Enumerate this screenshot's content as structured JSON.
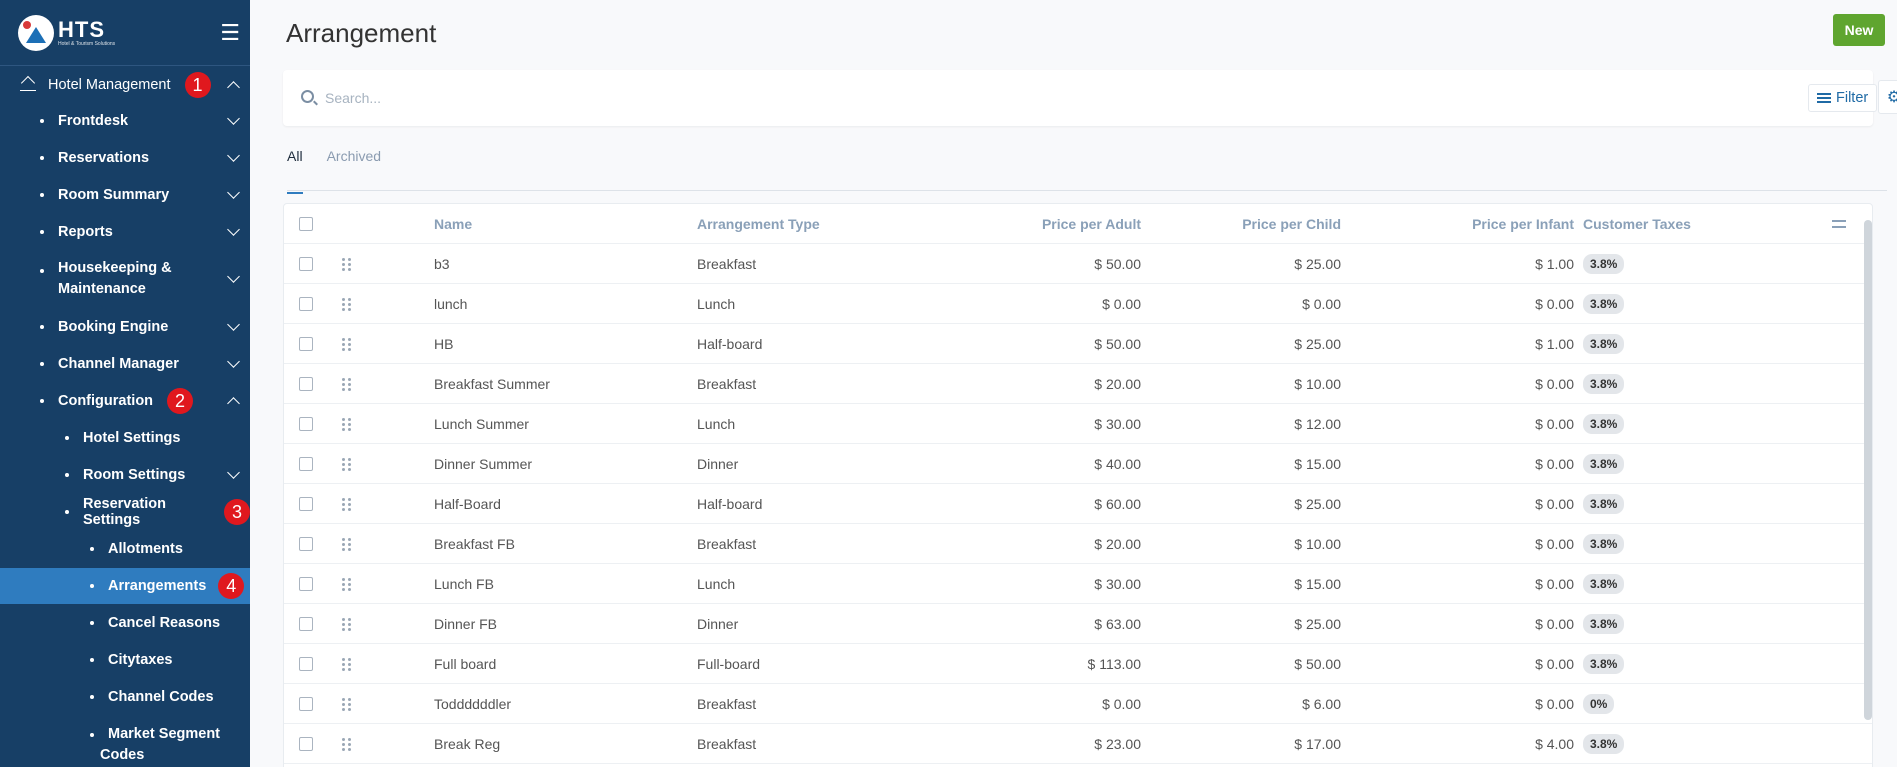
{
  "sidebar": {
    "logo": {
      "main": "HTS",
      "sub": "Hotel & Tourism Solutions"
    },
    "items": [
      {
        "label": "Hotel Management",
        "badge": "1"
      },
      {
        "label": "Frontdesk"
      },
      {
        "label": "Reservations"
      },
      {
        "label": "Room Summary"
      },
      {
        "label": "Reports"
      },
      {
        "label": "Housekeeping &",
        "label2": "Maintenance"
      },
      {
        "label": "Booking Engine"
      },
      {
        "label": "Channel Manager"
      },
      {
        "label": "Configuration",
        "badge": "2"
      },
      {
        "label": "Hotel Settings"
      },
      {
        "label": "Room Settings"
      },
      {
        "label": "Reservation Settings",
        "badge": "3"
      },
      {
        "label": "Allotments"
      },
      {
        "label": "Arrangements",
        "badge": "4"
      },
      {
        "label": "Cancel Reasons"
      },
      {
        "label": "Citytaxes"
      },
      {
        "label": "Channel Codes"
      },
      {
        "label": "Market Segment",
        "label2": "Codes"
      }
    ]
  },
  "header": {
    "title": "Arrangement",
    "new_label": "New"
  },
  "search": {
    "placeholder": "Search...",
    "filter_label": "Filter"
  },
  "tabs": [
    {
      "label": "All"
    },
    {
      "label": "Archived"
    }
  ],
  "table": {
    "columns": [
      "Name",
      "Arrangement Type",
      "Price per Adult",
      "Price per Child",
      "Price per Infant",
      "Customer Taxes"
    ],
    "rows": [
      {
        "name": "b3",
        "type": "Breakfast",
        "adult": "$ 50.00",
        "child": "$ 25.00",
        "infant": "$ 1.00",
        "tax": "3.8%"
      },
      {
        "name": "lunch",
        "type": "Lunch",
        "adult": "$ 0.00",
        "child": "$ 0.00",
        "infant": "$ 0.00",
        "tax": "3.8%"
      },
      {
        "name": "HB",
        "type": "Half-board",
        "adult": "$ 50.00",
        "child": "$ 25.00",
        "infant": "$ 1.00",
        "tax": "3.8%"
      },
      {
        "name": "Breakfast Summer",
        "type": "Breakfast",
        "adult": "$ 20.00",
        "child": "$ 10.00",
        "infant": "$ 0.00",
        "tax": "3.8%"
      },
      {
        "name": "Lunch Summer",
        "type": "Lunch",
        "adult": "$ 30.00",
        "child": "$ 12.00",
        "infant": "$ 0.00",
        "tax": "3.8%"
      },
      {
        "name": "Dinner Summer",
        "type": "Dinner",
        "adult": "$ 40.00",
        "child": "$ 15.00",
        "infant": "$ 0.00",
        "tax": "3.8%"
      },
      {
        "name": "Half-Board",
        "type": "Half-board",
        "adult": "$ 60.00",
        "child": "$ 25.00",
        "infant": "$ 0.00",
        "tax": "3.8%"
      },
      {
        "name": "Breakfast FB",
        "type": "Breakfast",
        "adult": "$ 20.00",
        "child": "$ 10.00",
        "infant": "$ 0.00",
        "tax": "3.8%"
      },
      {
        "name": "Lunch FB",
        "type": "Lunch",
        "adult": "$ 30.00",
        "child": "$ 15.00",
        "infant": "$ 0.00",
        "tax": "3.8%"
      },
      {
        "name": "Dinner FB",
        "type": "Dinner",
        "adult": "$ 63.00",
        "child": "$ 25.00",
        "infant": "$ 0.00",
        "tax": "3.8%"
      },
      {
        "name": "Full board",
        "type": "Full-board",
        "adult": "$ 113.00",
        "child": "$ 50.00",
        "infant": "$ 0.00",
        "tax": "3.8%"
      },
      {
        "name": "Toddddddler",
        "type": "Breakfast",
        "adult": "$ 0.00",
        "child": "$ 6.00",
        "infant": "$ 0.00",
        "tax": "0%"
      },
      {
        "name": "Break Reg",
        "type": "Breakfast",
        "adult": "$ 23.00",
        "child": "$ 17.00",
        "infant": "$ 4.00",
        "tax": "3.8%"
      }
    ]
  },
  "colors": {
    "sidebar_bg": "#173f66",
    "active_bg": "#2f7cbf",
    "badge_red": "#e0181e",
    "new_green": "#5fa52f"
  }
}
